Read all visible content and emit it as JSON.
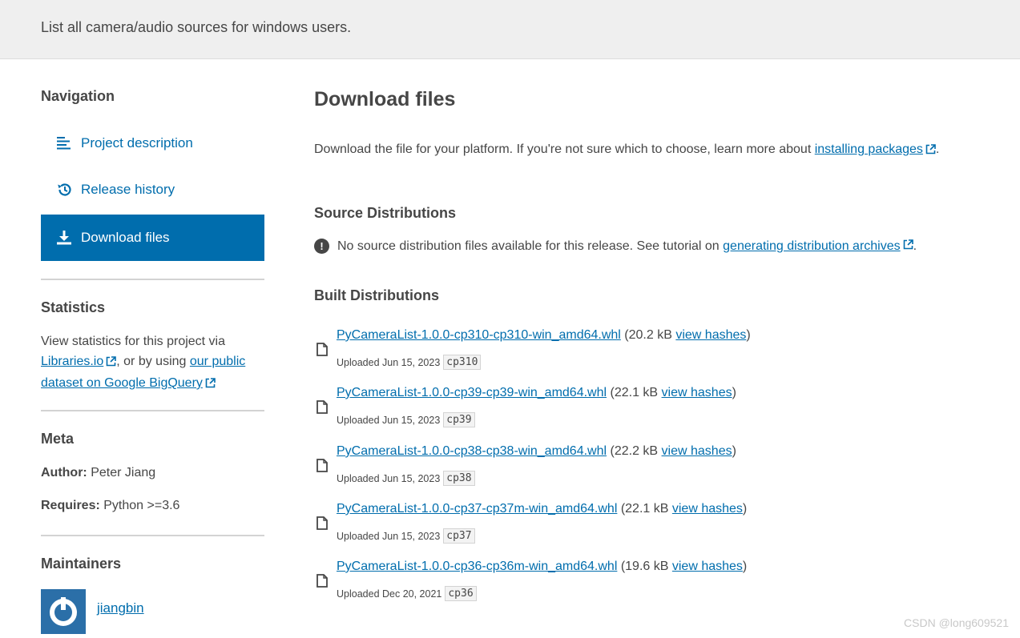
{
  "banner": {
    "text": "List all camera/audio sources for windows users."
  },
  "sidebar": {
    "navigation_heading": "Navigation",
    "nav_items": [
      {
        "label": "Project description",
        "icon": "align-left-icon",
        "active": false
      },
      {
        "label": "Release history",
        "icon": "history-icon",
        "active": false
      },
      {
        "label": "Download files",
        "icon": "download-icon",
        "active": true
      }
    ],
    "statistics": {
      "heading": "Statistics",
      "text_before": "View statistics for this project via",
      "libraries_link": "Libraries.io",
      "text_middle": ", or by using",
      "dataset_link_part1": "our public",
      "dataset_link_part2": "dataset on Google BigQuery"
    },
    "meta": {
      "heading": "Meta",
      "author_label": "Author:",
      "author_value": "Peter Jiang",
      "requires_label": "Requires:",
      "requires_value": "Python >=3.6"
    },
    "maintainers": {
      "heading": "Maintainers",
      "name": "jiangbin"
    }
  },
  "main": {
    "title": "Download files",
    "intro_text": "Download the file for your platform. If you're not sure which to choose, learn more about",
    "intro_link": "installing packages",
    "source_heading": "Source Distributions",
    "source_notice": "No source distribution files available for this release. See tutorial on",
    "source_link": "generating distribution archives",
    "built_heading": "Built Distributions",
    "files": [
      {
        "name": "PyCameraList-1.0.0-cp310-cp310-win_amd64.whl",
        "size": "(20.2 kB",
        "hashes": "view hashes",
        "close": ")",
        "uploaded": "Uploaded Jun 15, 2023",
        "tag": "cp310"
      },
      {
        "name": "PyCameraList-1.0.0-cp39-cp39-win_amd64.whl",
        "size": "(22.1 kB",
        "hashes": "view hashes",
        "close": ")",
        "uploaded": "Uploaded Jun 15, 2023",
        "tag": "cp39"
      },
      {
        "name": "PyCameraList-1.0.0-cp38-cp38-win_amd64.whl",
        "size": "(22.2 kB",
        "hashes": "view hashes",
        "close": ")",
        "uploaded": "Uploaded Jun 15, 2023",
        "tag": "cp38"
      },
      {
        "name": "PyCameraList-1.0.0-cp37-cp37m-win_amd64.whl",
        "size": "(22.1 kB",
        "hashes": "view hashes",
        "close": ")",
        "uploaded": "Uploaded Jun 15, 2023",
        "tag": "cp37"
      },
      {
        "name": "PyCameraList-1.0.0-cp36-cp36m-win_amd64.whl",
        "size": "(19.6 kB",
        "hashes": "view hashes",
        "close": ")",
        "uploaded": "Uploaded Dec 20, 2021",
        "tag": "cp36"
      }
    ]
  },
  "watermark": "CSDN @long609521",
  "colors": {
    "accent": "#006dad",
    "banner_bg": "#efefef",
    "text": "#464646"
  }
}
